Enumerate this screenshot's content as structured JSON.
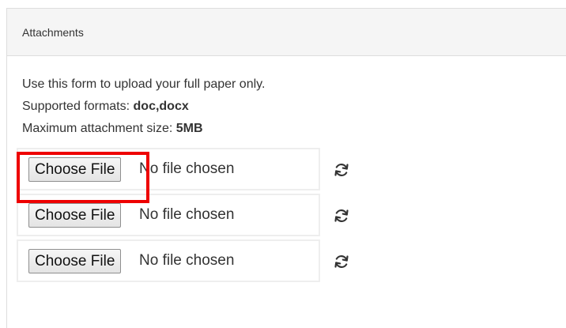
{
  "panel": {
    "title": "Attachments"
  },
  "instructions": {
    "line1": "Use this form to upload your full paper only.",
    "formats_label": "Supported formats: ",
    "formats_value": "doc,docx",
    "size_label": "Maximum attachment size: ",
    "size_value": "5MB"
  },
  "file_inputs": [
    {
      "button_label": "Choose File",
      "status": "No file chosen",
      "icon": "refresh-icon"
    },
    {
      "button_label": "Choose File",
      "status": "No file chosen",
      "icon": "refresh-icon"
    },
    {
      "button_label": "Choose File",
      "status": "No file chosen",
      "icon": "refresh-icon"
    }
  ],
  "colors": {
    "highlight": "#ee0000",
    "heading_bg": "#f5f5f5",
    "border": "#dddddd"
  }
}
